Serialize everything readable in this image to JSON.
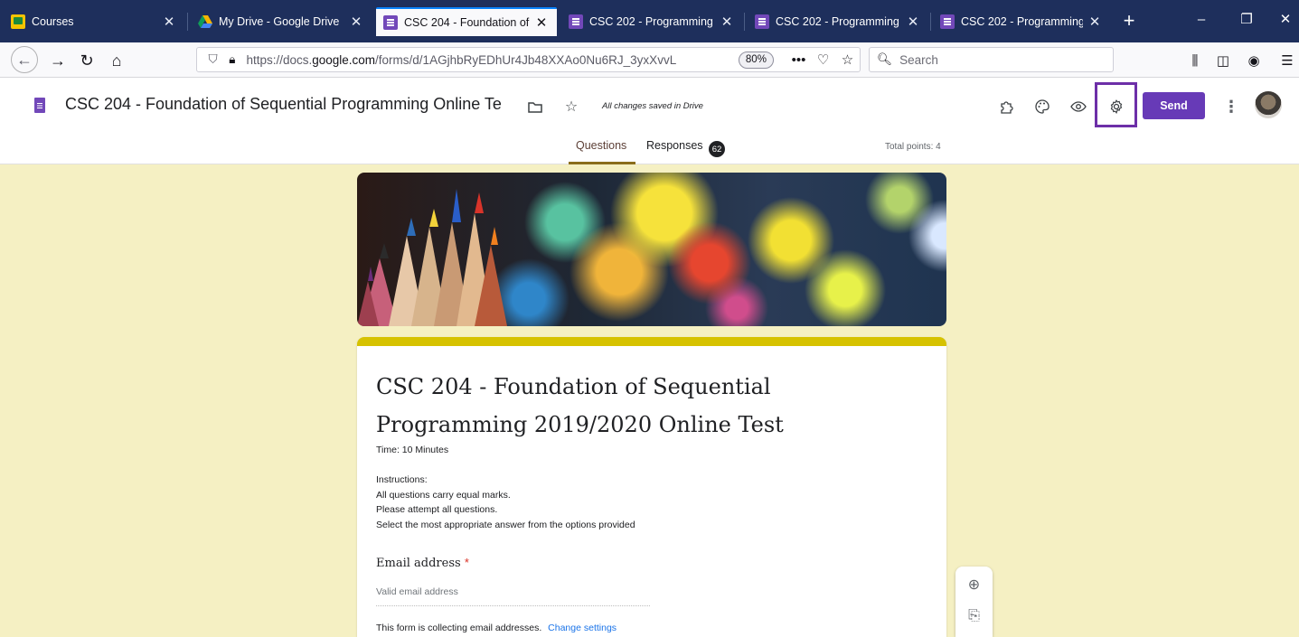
{
  "browser": {
    "tabs": [
      {
        "title": "Courses",
        "icon": "classroom-icon",
        "active": false
      },
      {
        "title": "My Drive - Google Drive",
        "icon": "drive-icon",
        "active": false
      },
      {
        "title": "CSC 204 - Foundation of",
        "icon": "forms-icon",
        "active": true
      },
      {
        "title": "CSC 202 - Programming",
        "icon": "forms-icon",
        "active": false
      },
      {
        "title": "CSC 202 - Programming",
        "icon": "forms-icon",
        "active": false
      },
      {
        "title": "CSC 202 - Programming",
        "icon": "forms-icon",
        "active": false
      }
    ],
    "url_prefix": "https://docs.",
    "url_domain": "google.com",
    "url_rest": "/forms/d/1AGjhbRyEDhUr4Jb48XXAo0Nu6RJ_3yxXvvL",
    "zoom": "80%",
    "search_placeholder": "Search"
  },
  "form_header": {
    "title": "CSC 204 - Foundation of Sequential Programming Online Te",
    "save_status": "All changes saved in Drive",
    "send_label": "Send",
    "tabs": {
      "questions": "Questions",
      "responses": "Responses",
      "responses_count": "62"
    },
    "total_points": "Total points: 4"
  },
  "form": {
    "title": "CSC 204 - Foundation of Sequential Programming 2019/2020 Online Test",
    "description": "Time: 10 Minutes\n\nInstructions:\nAll questions carry equal marks.\nPlease attempt all questions.\nSelect the most appropriate answer from the options provided",
    "email_label": "Email address",
    "required_mark": "*",
    "email_placeholder": "Valid email address",
    "collecting_note": "This form is collecting email addresses.",
    "change_settings": "Change settings"
  },
  "colors": {
    "tabstrip": "#1e2f5c",
    "page_background": "#f5f0c3",
    "accent": "#673ab7",
    "card_top_border": "#d6c200",
    "highlight_box": "#6d2fa8"
  }
}
